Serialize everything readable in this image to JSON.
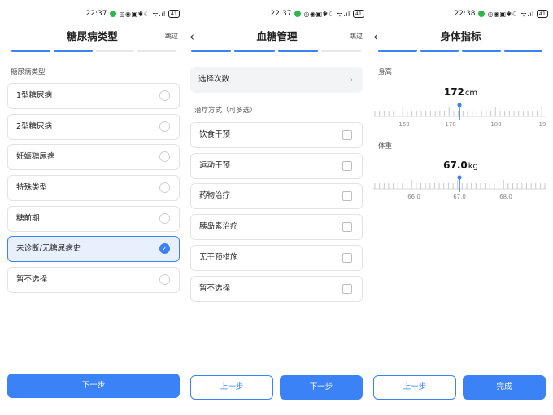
{
  "status_bar": {
    "screen1_time": "22:37",
    "screen2_time": "22:37",
    "screen3_time": "22:38",
    "battery": "41"
  },
  "screen1": {
    "title": "糖尿病类型",
    "skip": "跳过",
    "progress_total": 4,
    "progress_done": 2,
    "section_label": "糖尿病类型",
    "options": [
      {
        "label": "1型糖尿病",
        "selected": false
      },
      {
        "label": "2型糖尿病",
        "selected": false
      },
      {
        "label": "妊娠糖尿病",
        "selected": false
      },
      {
        "label": "特殊类型",
        "selected": false
      },
      {
        "label": "糖前期",
        "selected": false
      },
      {
        "label": "未诊断/无糖尿病史",
        "selected": true
      },
      {
        "label": "暂不选择",
        "selected": false
      }
    ],
    "next_label": "下一步"
  },
  "screen2": {
    "title": "血糖管理",
    "skip": "跳过",
    "progress_total": 4,
    "progress_done": 3,
    "select_frequency": "选择次数",
    "section_label": "治疗方式（可多选）",
    "treatments": [
      "饮食干预",
      "运动干预",
      "药物治疗",
      "胰岛素治疗",
      "无干预措施",
      "暂不选择"
    ],
    "prev_label": "上一步",
    "next_label": "下一步"
  },
  "screen3": {
    "title": "身体指标",
    "progress_total": 4,
    "progress_done": 4,
    "height_label": "身高",
    "height_value": "172",
    "height_unit": "cm",
    "height_ticks": [
      "160",
      "170",
      "180",
      "19"
    ],
    "weight_label": "体重",
    "weight_value": "67.0",
    "weight_unit": "kg",
    "weight_ticks": [
      "66.0",
      "67.0",
      "68.0"
    ],
    "prev_label": "上一步",
    "finish_label": "完成"
  },
  "colors": {
    "accent": "#3b82f6",
    "selected_bg": "#e9f0fd"
  },
  "icons": [
    "back-chevron-icon",
    "chevron-right-icon",
    "radio-checked-icon",
    "ruler-marker-icon"
  ]
}
